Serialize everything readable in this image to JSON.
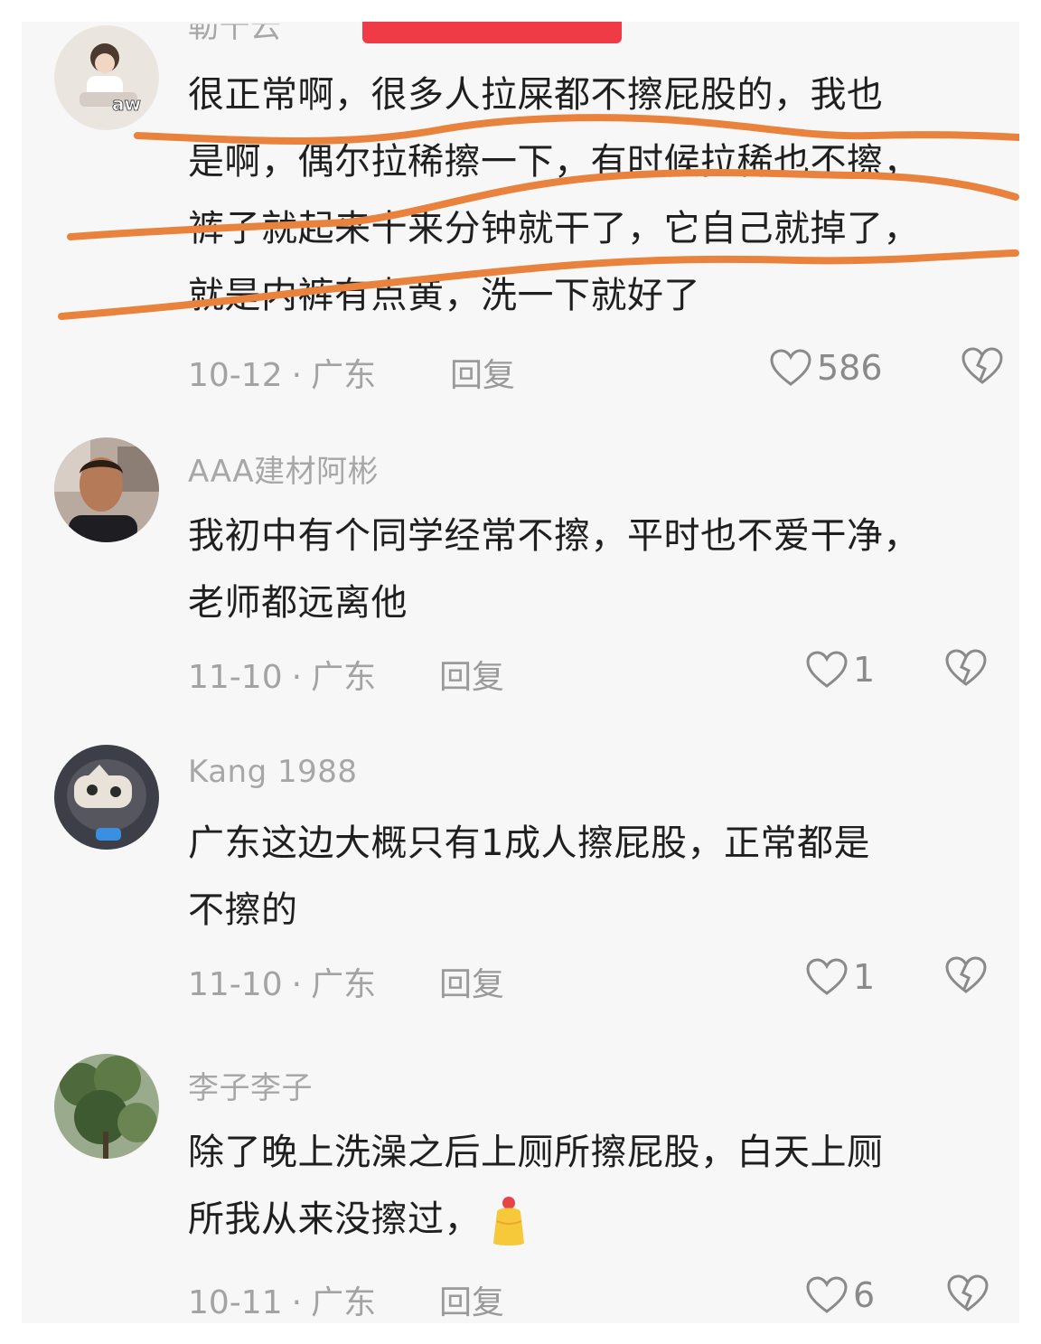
{
  "top_bar": {
    "color": "#ef3b45"
  },
  "annotation_color": "#e8823c",
  "comments": [
    {
      "username": "勒十云",
      "lines": [
        "很正常啊，很多人拉屎都不擦屁股的，我也",
        "是啊，偶尔拉稀擦一下，有时候拉稀也不擦，",
        "裤子就起来十来分钟就干了，它自己就掉了，",
        "就是内裤有点黄，洗一下就好了"
      ],
      "date": "10-12",
      "sep": "·",
      "location": "广东",
      "reply": "回复",
      "likes": "586",
      "avatar_icon": "avatar-girl"
    },
    {
      "username": "AAA建材阿彬",
      "lines": [
        "我初中有个同学经常不擦，平时也不爱干净，",
        "老师都远离他"
      ],
      "date": "11-10",
      "sep": "·",
      "location": "广东",
      "reply": "回复",
      "likes": "1",
      "avatar_icon": "avatar-man"
    },
    {
      "username": "Kang 1988",
      "lines": [
        "广东这边大概只有1成人擦屁股，正常都是",
        "不擦的"
      ],
      "date": "11-10",
      "sep": "·",
      "location": "广东",
      "reply": "回复",
      "likes": "1",
      "avatar_icon": "avatar-cartoon"
    },
    {
      "username": "李子李子",
      "lines": [
        "除了晚上洗澡之后上厕所擦屁股，白天上厕",
        "所我从来没擦过，"
      ],
      "date": "10-11",
      "sep": "·",
      "location": "广东",
      "reply": "回复",
      "likes": "6",
      "avatar_icon": "avatar-tree",
      "trailing_emoji": "cake-emoji"
    }
  ]
}
